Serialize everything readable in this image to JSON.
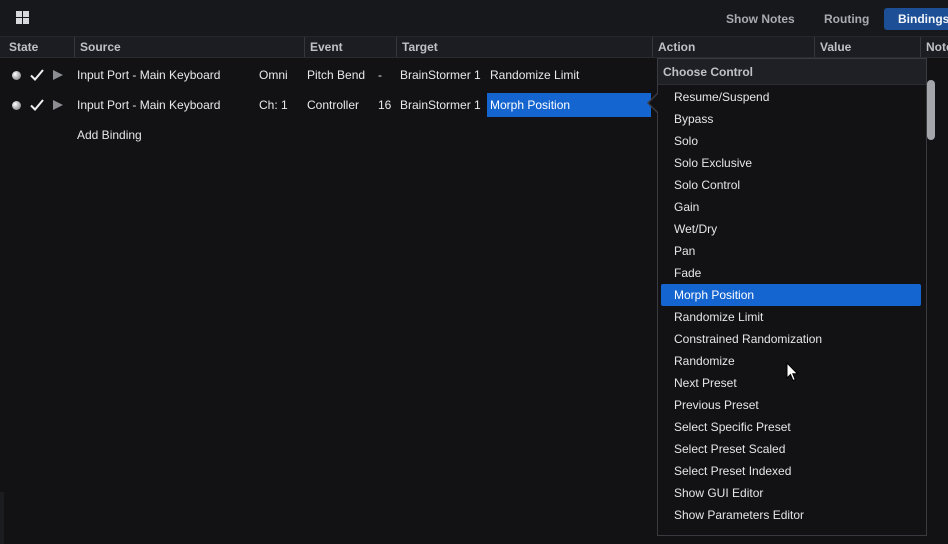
{
  "toolbar": {
    "tabs": [
      {
        "label": "Show Notes"
      },
      {
        "label": "Routing"
      },
      {
        "label": "Bindings",
        "active": true
      }
    ]
  },
  "table": {
    "columns": [
      "State",
      "Source",
      "Event",
      "Target",
      "Action",
      "Value",
      "Note"
    ],
    "rows": [
      {
        "source": "Input Port - Main Keyboard",
        "channel": "Omni",
        "event": "Pitch Bend",
        "event_num": "-",
        "target": "BrainStormer 1",
        "action": "Randomize Limit"
      },
      {
        "source": "Input Port - Main Keyboard",
        "channel": "Ch: 1",
        "event": "Controller",
        "event_num": "16",
        "target": "BrainStormer 1",
        "action": "Morph Position"
      }
    ],
    "add_binding": "Add Binding"
  },
  "dropdown": {
    "title": "Choose Control",
    "items": [
      "Resume/Suspend",
      "Bypass",
      "Solo",
      "Solo Exclusive",
      "Solo Control",
      "Gain",
      "Wet/Dry",
      "Pan",
      "Fade",
      "Morph Position",
      "Randomize Limit",
      "Constrained Randomization",
      "Randomize",
      "Next Preset",
      "Previous Preset",
      "Select Specific Preset",
      "Select Preset Scaled",
      "Select Preset Indexed",
      "Show GUI Editor",
      "Show Parameters Editor"
    ],
    "selected": "Morph Position"
  },
  "colors": {
    "accent": "#1565d1",
    "active_tab": "#1d4f96",
    "background": "#121215"
  },
  "icons": [
    "grid-icon",
    "state-dot-icon",
    "checkmark-icon",
    "play-triangle-icon",
    "mouse-pointer-icon"
  ]
}
